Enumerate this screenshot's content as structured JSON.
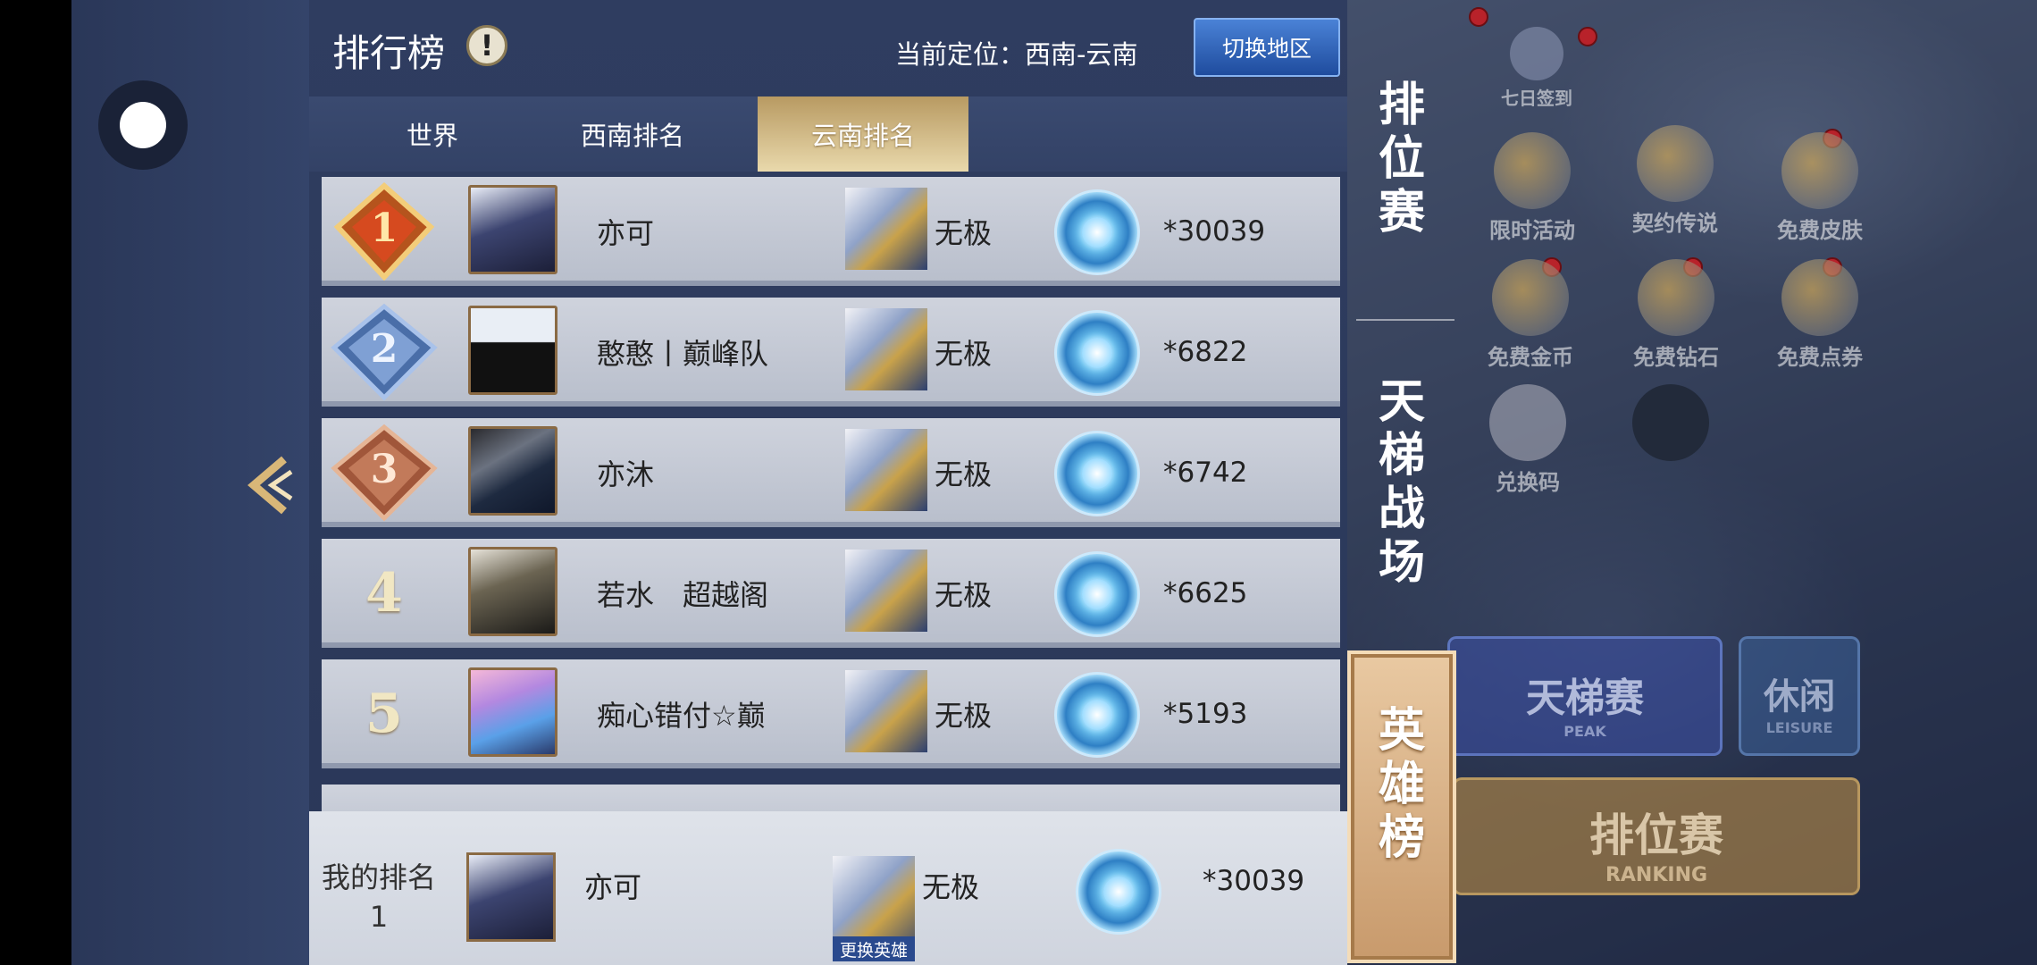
{
  "header": {
    "title": "排行榜",
    "info_icon": "!",
    "location": "当前定位：西南-云南",
    "switch_button": "切换地区"
  },
  "tabs": [
    {
      "label": "世界",
      "active": false
    },
    {
      "label": "西南排名",
      "active": false
    },
    {
      "label": "云南排名",
      "active": true
    }
  ],
  "rows": [
    {
      "rank": "1",
      "name": "亦可",
      "hero": "无极",
      "score": "*30039"
    },
    {
      "rank": "2",
      "name": "憨憨丨巅峰队",
      "hero": "无极",
      "score": "*6822"
    },
    {
      "rank": "3",
      "name": "亦沐",
      "hero": "无极",
      "score": "*6742"
    },
    {
      "rank": "4",
      "name": "若水　超越阁",
      "hero": "无极",
      "score": "*6625"
    },
    {
      "rank": "5",
      "name": "痴心错付☆巅",
      "hero": "无极",
      "score": "*5193"
    }
  ],
  "my_rank": {
    "label": "我的排名",
    "rank": "1",
    "name": "亦可",
    "hero": "无极",
    "change_hero": "更换英雄",
    "score": "*30039"
  },
  "vertical_tabs": [
    {
      "label": "排位赛",
      "active": false
    },
    {
      "label": "天梯战场",
      "active": false
    },
    {
      "label": "英雄榜",
      "active": true
    }
  ],
  "background": {
    "events": [
      {
        "label": "限时活动",
        "icon": "gift-icon"
      },
      {
        "label": "契约传说",
        "icon": "hero-portrait-icon"
      },
      {
        "label": "免费皮肤",
        "icon": "skin-icon"
      },
      {
        "label": "免费金币",
        "icon": "coin-icon"
      },
      {
        "label": "免费钻石",
        "icon": "diamond-icon"
      },
      {
        "label": "免费点券",
        "icon": "coupon-icon"
      },
      {
        "label": "兑换码",
        "icon": "tag-icon"
      }
    ],
    "top_labels": [
      "七日签到"
    ],
    "ladder": {
      "label": "天梯赛",
      "sub": "PEAK"
    },
    "leisure": {
      "label": "休闲",
      "sub": "LEISURE"
    },
    "ranking": {
      "label": "排位赛",
      "sub": "RANKING"
    }
  },
  "colors": {
    "panel_bg": "#2f3d60",
    "row_bg": "#c4c9d4",
    "active_tab_gold": "#d8c28e",
    "switch_button_blue": "#2f63b8"
  }
}
